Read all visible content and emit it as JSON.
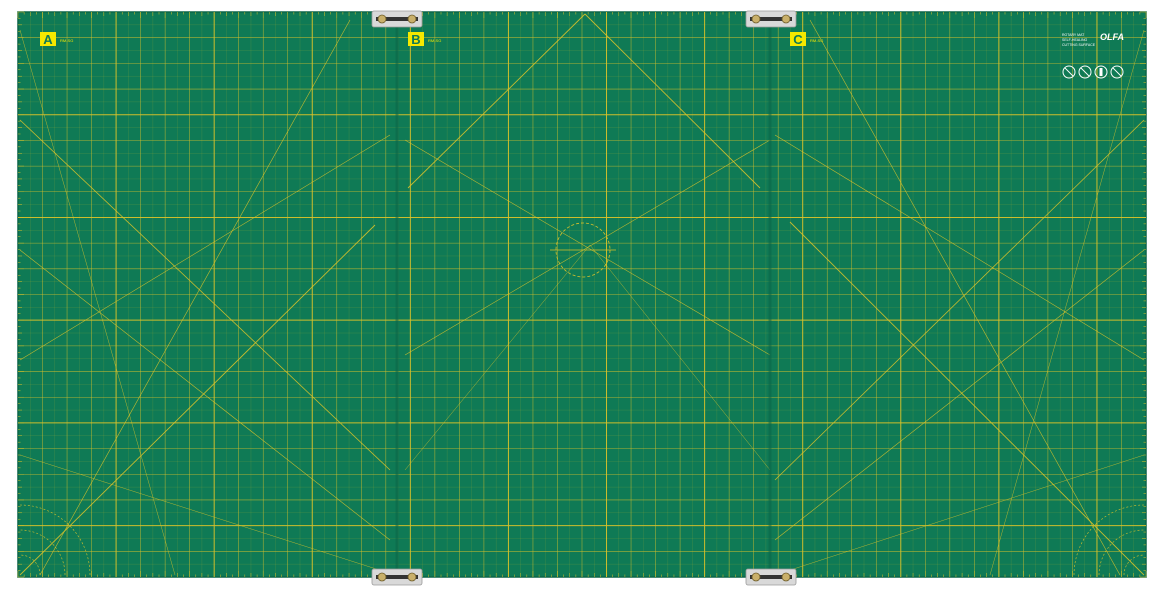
{
  "mat": {
    "colors": {
      "background": "#ffffff",
      "mat_green": "#0f7a55",
      "mat_edge": "#0b6447",
      "grid_yellow": "#d8c22a",
      "label_yellow": "#f5e800",
      "label_text": "#0f7a55",
      "clip_metal": "#d9d9d9",
      "clip_dark": "#333333"
    },
    "panels": [
      {
        "letter": "A",
        "tag": "RM-SG"
      },
      {
        "letter": "B",
        "tag": "RM-SG"
      },
      {
        "letter": "C",
        "tag": "RM-SG"
      }
    ],
    "brand": {
      "logo": "OLFA",
      "caption_lines": [
        "ROTARY MAT",
        "SELF-HEALING",
        "CUTTING SURFACE"
      ]
    },
    "care_icons": [
      "no-heat-icon",
      "no-sun-icon",
      "store-flat-icon",
      "no-dishwasher-icon"
    ],
    "clips": [
      {
        "name": "clip-top-left"
      },
      {
        "name": "clip-top-right"
      },
      {
        "name": "clip-bottom-left"
      },
      {
        "name": "clip-bottom-right"
      }
    ],
    "ruler": {
      "columns": 46,
      "rows": 22,
      "major_every": 4
    }
  }
}
